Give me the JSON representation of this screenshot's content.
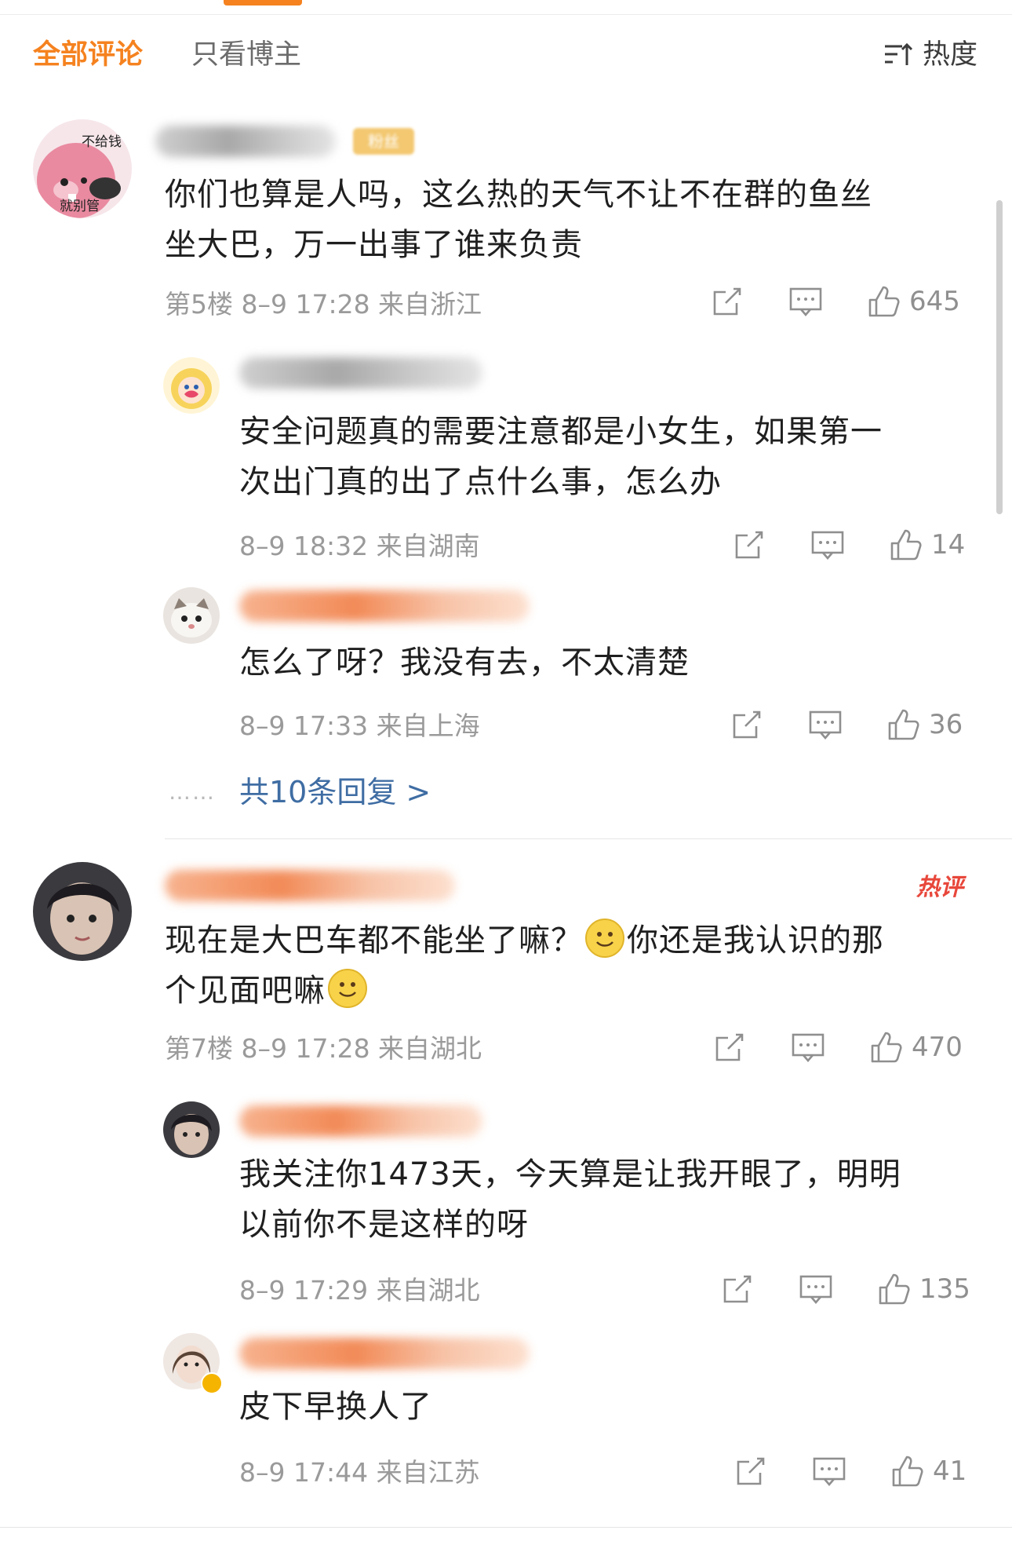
{
  "tabs": {
    "all": "全部评论",
    "owner_only": "只看博主"
  },
  "sort": {
    "icon": "sort-icon",
    "label": "热度"
  },
  "accent_color": "#f5821f",
  "avatar1_text": {
    "a": "不给钱",
    "b": "就别管"
  },
  "badge_new": "粉丝",
  "hot_tag": "热评",
  "comments": [
    {
      "text": [
        "你们也算是人吗，这么热的天气不让不在群的鱼丝",
        "坐大巴，万一出事了谁来负责"
      ],
      "meta": "第5楼 8–9 17:28 来自浙江",
      "likes": "645"
    },
    {
      "text": [
        "安全问题真的需要注意都是小女生，如果第一",
        "次出门真的出了点什么事，怎么办"
      ],
      "meta": "8–9 18:32 来自湖南",
      "likes": "14"
    },
    {
      "text": [
        "怎么了呀？我没有去，不太清楚"
      ],
      "meta": "8–9 17:33 来自上海",
      "likes": "36"
    },
    {
      "text": [
        "现在是大巴车都不能坐了嘛？",
        "你还是我认识的那",
        "个见面吧嘛"
      ],
      "meta": "第7楼 8–9 17:28 来自湖北",
      "likes": "470"
    },
    {
      "text": [
        "我关注你1473天，今天算是让我开眼了，明明",
        "以前你不是这样的呀"
      ],
      "meta": "8–9 17:29 来自湖北",
      "likes": "135"
    },
    {
      "text": [
        "皮下早换人了"
      ],
      "meta": "8–9 17:44 来自江苏",
      "likes": "41"
    }
  ],
  "more_replies": {
    "dots": "……",
    "label": "共10条回复 >"
  }
}
